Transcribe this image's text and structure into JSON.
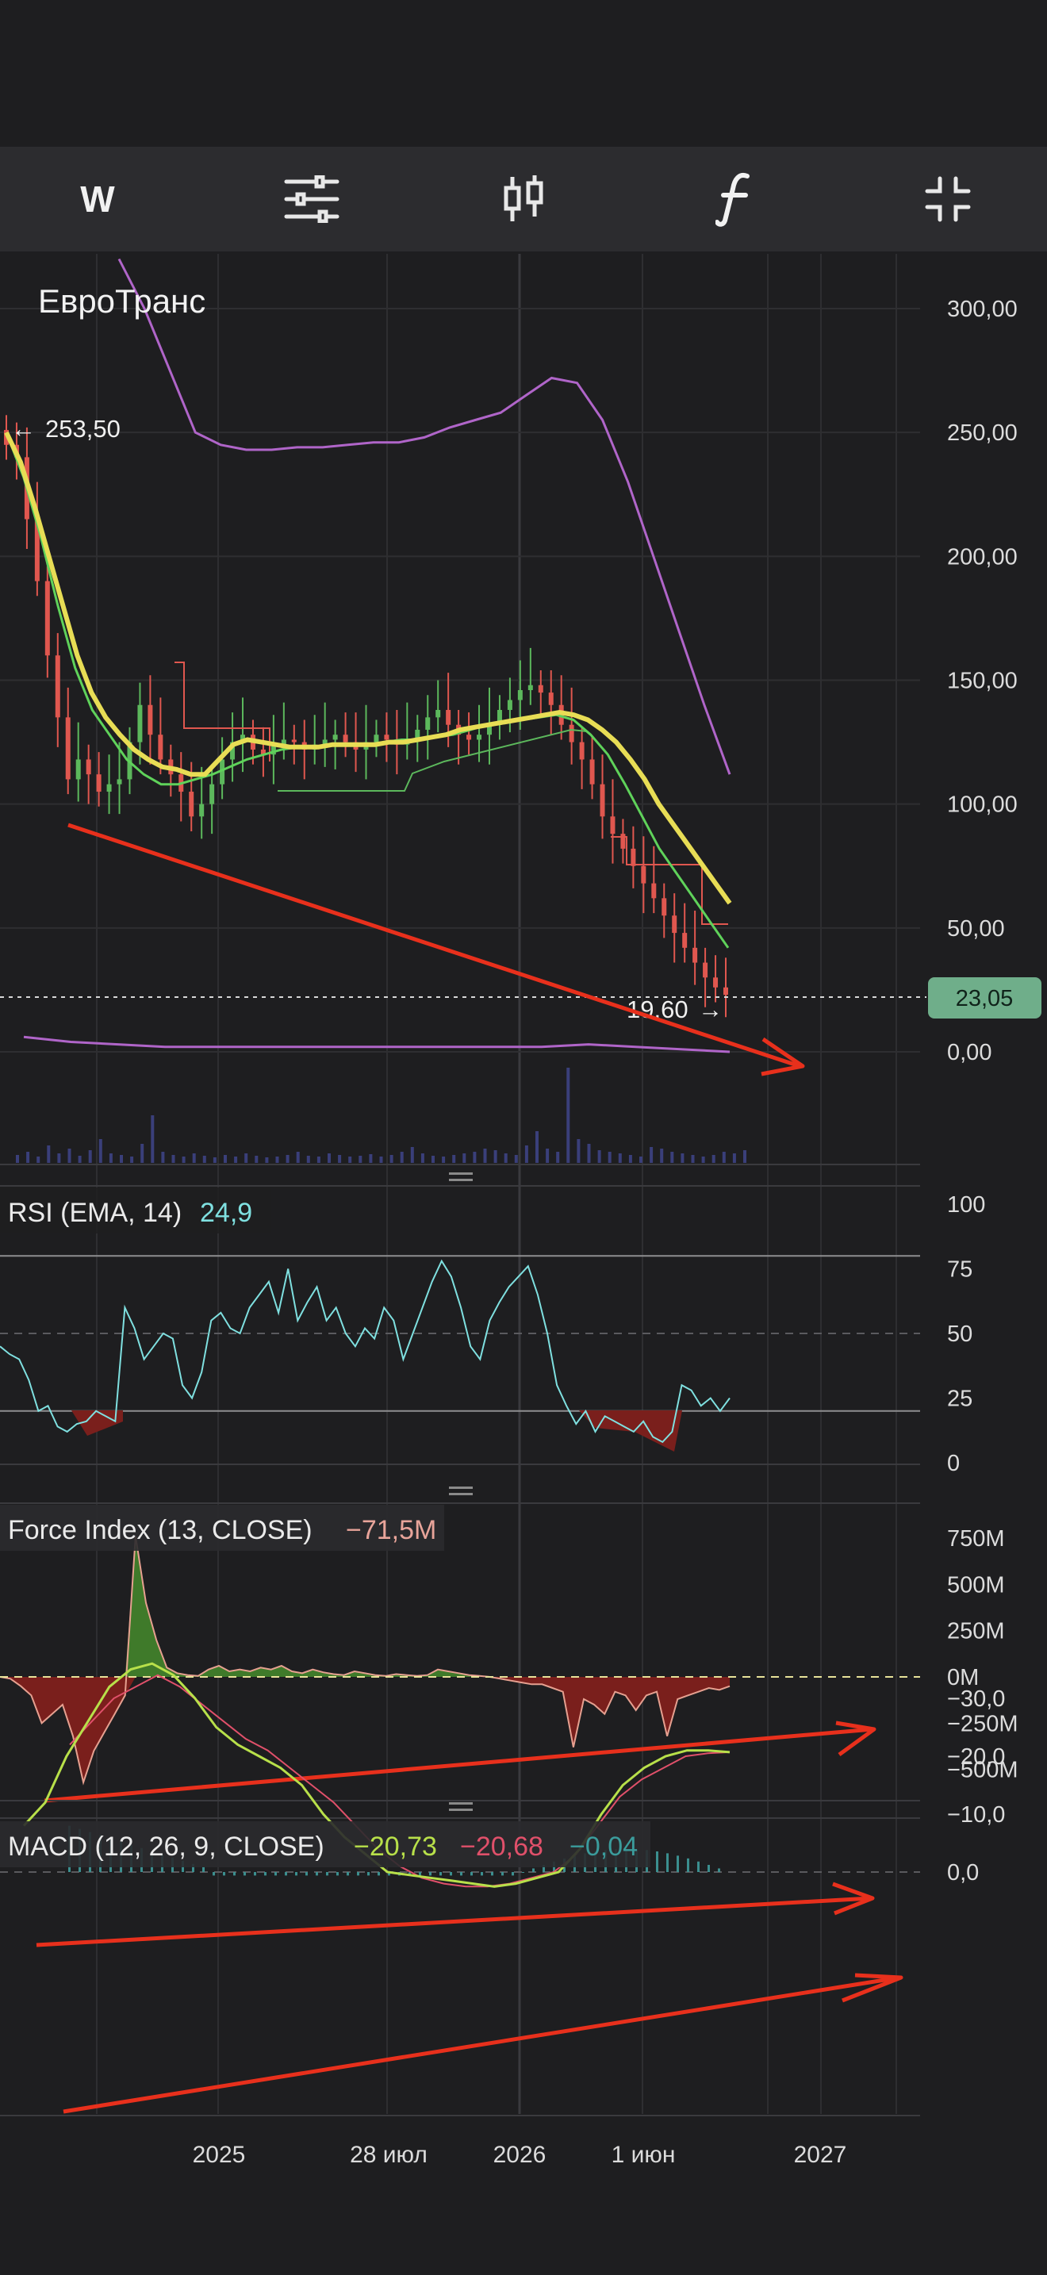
{
  "toolbar": {
    "interval_label": "W",
    "items": [
      "interval-button",
      "settings-sliders-icon",
      "candles-icon",
      "indicators-icon",
      "collapse-icon"
    ]
  },
  "colors": {
    "background": "#1e1e20",
    "grid": "#2e2e31",
    "up": "#5cb85c",
    "down": "#e0574f",
    "ema_yellow": "#e8dd55",
    "ema_green": "#5fd25a",
    "bollinger_purple": "#b065c9",
    "rsi_cyan": "#7fe0e0",
    "macd_line": "#b8e04a",
    "signal_line": "#e0506a",
    "price_badge": "#6fae8a",
    "trend_arrows": "#e8301c"
  },
  "chart_data": [
    {
      "type": "candlestick",
      "panel": "price",
      "title": "ЕвроТранс",
      "x_tick_labels": [
        "2025",
        "28 июл",
        "2026",
        "1 июн",
        "2027"
      ],
      "y_tick_labels": [
        "300,00",
        "250,00",
        "200,00",
        "150,00",
        "100,00",
        "50,00",
        "0,00"
      ],
      "ylim": [
        -45,
        320
      ],
      "last_price_label": "23,05",
      "max_label": "253,50",
      "min_label": "19,60",
      "close_approx": [
        245,
        240,
        215,
        190,
        160,
        135,
        110,
        118,
        112,
        105,
        108,
        110,
        125,
        140,
        128,
        118,
        112,
        105,
        95,
        100,
        108,
        118,
        125,
        128,
        122,
        120,
        124,
        126,
        125,
        122,
        124,
        126,
        128,
        125,
        122,
        125,
        128,
        126,
        124,
        126,
        130,
        135,
        138,
        132,
        128,
        126,
        128,
        132,
        138,
        142,
        146,
        148,
        145,
        140,
        132,
        125,
        118,
        108,
        95,
        88,
        82,
        75,
        68,
        62,
        55,
        48,
        42,
        36,
        30,
        26,
        23
      ],
      "series": [
        {
          "name": "EMA",
          "values": [
            250,
            238,
            220,
            200,
            180,
            160,
            145,
            135,
            128,
            122,
            118,
            115,
            114,
            112,
            112,
            118,
            124,
            126,
            125,
            124,
            123,
            123,
            123,
            124,
            124,
            124,
            124,
            125,
            125,
            126,
            127,
            128,
            130,
            131,
            132,
            133,
            134,
            135,
            136,
            137,
            136,
            134,
            130,
            125,
            118,
            110,
            100,
            92,
            84,
            76,
            68,
            60
          ]
        },
        {
          "name": "EMA",
          "values": [
            250,
            232,
            208,
            180,
            155,
            138,
            128,
            118,
            112,
            108,
            108,
            110,
            112,
            115,
            118,
            120,
            122,
            123,
            123,
            124,
            124,
            124,
            125,
            126,
            126,
            127,
            128,
            130,
            132,
            133,
            134,
            135,
            136,
            134,
            128,
            120,
            108,
            95,
            82,
            72,
            62,
            52,
            42
          ]
        },
        {
          "name": "Bollinger",
          "values": [
            320,
            300,
            275,
            250,
            245,
            243,
            243,
            244,
            244,
            245,
            246,
            246,
            248,
            252,
            255,
            258,
            265,
            272,
            270,
            255,
            230,
            200,
            170,
            140,
            112
          ]
        },
        {
          "name": "Bollinger",
          "values": [
            6,
            4,
            3,
            2,
            2,
            2,
            2,
            2,
            2,
            2,
            2,
            2,
            3,
            2,
            1,
            0
          ]
        }
      ]
    },
    {
      "type": "line",
      "panel": "rsi",
      "label": "RSI (EMA, 14)",
      "value_label": "24,9",
      "y_tick_labels": [
        "100",
        "75",
        "50",
        "25",
        "0"
      ],
      "ylim": [
        -5,
        108
      ],
      "levels": [
        80,
        20
      ],
      "values": [
        45,
        42,
        40,
        32,
        20,
        22,
        14,
        12,
        15,
        16,
        20,
        18,
        16,
        60,
        52,
        40,
        45,
        50,
        48,
        30,
        25,
        35,
        55,
        58,
        52,
        50,
        60,
        65,
        70,
        58,
        75,
        55,
        62,
        68,
        55,
        60,
        50,
        45,
        52,
        48,
        60,
        55,
        40,
        50,
        60,
        70,
        78,
        72,
        60,
        45,
        40,
        55,
        62,
        68,
        72,
        76,
        65,
        50,
        30,
        22,
        15,
        20,
        12,
        18,
        16,
        14,
        12,
        16,
        10,
        8,
        12,
        30,
        28,
        22,
        25,
        20,
        25
      ]
    },
    {
      "type": "area",
      "panel": "force_index",
      "label": "Force Index (13, CLOSE)",
      "value_label": "−71,5M",
      "y_tick_labels": [
        "750M",
        "500M",
        "250M",
        "0M",
        "−250M",
        "−500M"
      ],
      "ylim": [
        -650,
        820
      ],
      "values": [
        0,
        -10,
        -50,
        -100,
        -250,
        -200,
        -150,
        -320,
        -570,
        -400,
        -300,
        -200,
        -100,
        760,
        400,
        200,
        50,
        20,
        10,
        5,
        40,
        60,
        30,
        40,
        30,
        50,
        40,
        60,
        30,
        20,
        40,
        25,
        15,
        10,
        30,
        20,
        10,
        5,
        15,
        10,
        5,
        10,
        40,
        30,
        20,
        10,
        5,
        0,
        -10,
        -20,
        -30,
        -40,
        -40,
        -60,
        -80,
        -380,
        -120,
        -150,
        -200,
        -80,
        -100,
        -180,
        -100,
        -80,
        -320,
        -120,
        -100,
        -80,
        -60,
        -70,
        -50
      ]
    },
    {
      "type": "line",
      "panel": "macd",
      "label": "MACD (12, 26, 9, CLOSE)",
      "value_labels": [
        "−20,73",
        "−20,68",
        "−0,04"
      ],
      "y_tick_labels": [
        "0,0",
        "−10,0",
        "−20,0",
        "−30,0"
      ],
      "ylim": [
        -42,
        3
      ],
      "series": [
        {
          "name": "MACD",
          "values": [
            -8,
            -12,
            -20,
            -26,
            -32,
            -35,
            -36,
            -34,
            -30,
            -25,
            -22,
            -20,
            -18,
            -15,
            -10,
            -6,
            -3,
            0,
            0.5,
            1,
            1.5,
            2,
            2.5,
            2,
            1,
            0,
            -4,
            -10,
            -15,
            -18,
            -20,
            -21,
            -21,
            -20.7
          ]
        },
        {
          "name": "Signal",
          "values": [
            -22,
            -26,
            -30,
            -32,
            -34,
            -32,
            -29,
            -26,
            -23,
            -21,
            -18,
            -15,
            -12,
            -8,
            -4,
            -1,
            1,
            2,
            2.5,
            2.5,
            2,
            1,
            0,
            -3,
            -8,
            -13,
            -16,
            -18,
            -20,
            -20.5,
            -20.7
          ]
        }
      ]
    }
  ]
}
